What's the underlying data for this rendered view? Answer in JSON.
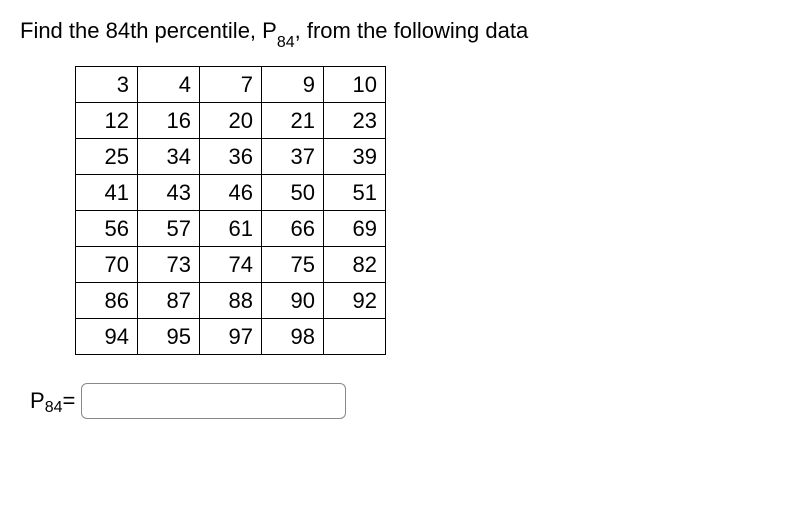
{
  "question": {
    "prefix": "Find the 84th percentile, P",
    "sub": "84",
    "suffix": ", from the following data"
  },
  "table": {
    "rows": [
      [
        "3",
        "4",
        "7",
        "9",
        "10"
      ],
      [
        "12",
        "16",
        "20",
        "21",
        "23"
      ],
      [
        "25",
        "34",
        "36",
        "37",
        "39"
      ],
      [
        "41",
        "43",
        "46",
        "50",
        "51"
      ],
      [
        "56",
        "57",
        "61",
        "66",
        "69"
      ],
      [
        "70",
        "73",
        "74",
        "75",
        "82"
      ],
      [
        "86",
        "87",
        "88",
        "90",
        "92"
      ],
      [
        "94",
        "95",
        "97",
        "98",
        ""
      ]
    ]
  },
  "answer": {
    "labelPrefix": "P",
    "labelSub": "84",
    "labelSuffix": " = ",
    "value": ""
  },
  "chart_data": {
    "type": "table",
    "title": "Find the 84th percentile, P84, from the following data",
    "values": [
      3,
      4,
      7,
      9,
      10,
      12,
      16,
      20,
      21,
      23,
      25,
      34,
      36,
      37,
      39,
      41,
      43,
      46,
      50,
      51,
      56,
      57,
      61,
      66,
      69,
      70,
      73,
      74,
      75,
      82,
      86,
      87,
      88,
      90,
      92,
      94,
      95,
      97,
      98
    ],
    "percentile_requested": 84
  }
}
